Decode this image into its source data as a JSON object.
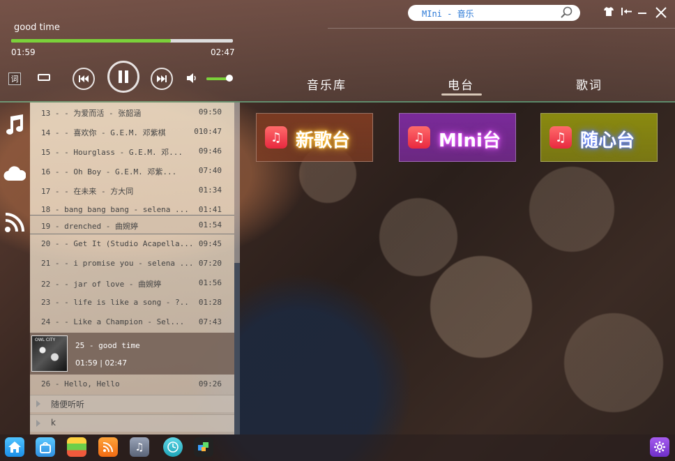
{
  "player": {
    "title": "good time",
    "current_time": "01:59",
    "total_time": "02:47",
    "progress_fraction": 0.72,
    "volume_fraction": 0.8,
    "lyric_btn": "词"
  },
  "search": {
    "placeholder": "MIni - 音乐"
  },
  "tabs": [
    {
      "label": "音乐库",
      "active": false
    },
    {
      "label": "电台",
      "active": true
    },
    {
      "label": "歌词",
      "active": false
    }
  ],
  "sidebar_icons": [
    "music-note-icon",
    "cloud-icon",
    "rss-icon"
  ],
  "playlist": {
    "rows": [
      {
        "text": "13 - - 为爱而活 - 张韶涵",
        "duration": "09:50"
      },
      {
        "text": "14 - - 喜欢你 - G.E.M. 邓紫棋",
        "duration": "010:47"
      },
      {
        "text": "15 -  - Hourglass - G.E.M.  邓...",
        "duration": "09:46"
      },
      {
        "text": "16 -  - Oh  Boy - G.E.M.  邓紫...",
        "duration": "07:40"
      },
      {
        "text": "17 -  - 在未来 - 方大同",
        "duration": "01:34"
      },
      {
        "text": "18 -  bang bang bang - selena ...",
        "duration": "01:41"
      },
      {
        "text": "19 -  drenched - 曲婉婷",
        "duration": "01:54"
      },
      {
        "text": "20 - - Get It (Studio Acapella...",
        "duration": "09:45"
      },
      {
        "text": "21 - - i promise you - selena ...",
        "duration": "07:20"
      },
      {
        "text": "22 - - jar of love - 曲婉婷",
        "duration": "01:56"
      },
      {
        "text": "23 - - life is like a song - ?..",
        "duration": "01:28"
      },
      {
        "text": "24 - - Like  a  Champion - Sel...",
        "duration": "07:43"
      }
    ],
    "now_playing": {
      "title": "25 -  good time",
      "time": "01:59 | 02:47",
      "art_text": "OWL CITY"
    },
    "after_rows": [
      {
        "text": "26 -  Hello,  Hello",
        "duration": "09:26"
      }
    ],
    "groups": [
      "随便听听",
      "k"
    ]
  },
  "radio_cards": [
    {
      "label": "新歌台",
      "bg": "#7a3a22",
      "glow": "#ffc23a"
    },
    {
      "label": "MIni台",
      "bg": "#7a2a9a",
      "glow": "#e65cff"
    },
    {
      "label": "随心台",
      "bg": "#8a8a10",
      "glow": "#5b7bff"
    }
  ],
  "dock_icons": [
    "home-icon",
    "store-icon",
    "folder-icon",
    "rss-icon",
    "itunes-icon",
    "clock-icon",
    "app-icon"
  ],
  "settings_icon": "gear-icon"
}
